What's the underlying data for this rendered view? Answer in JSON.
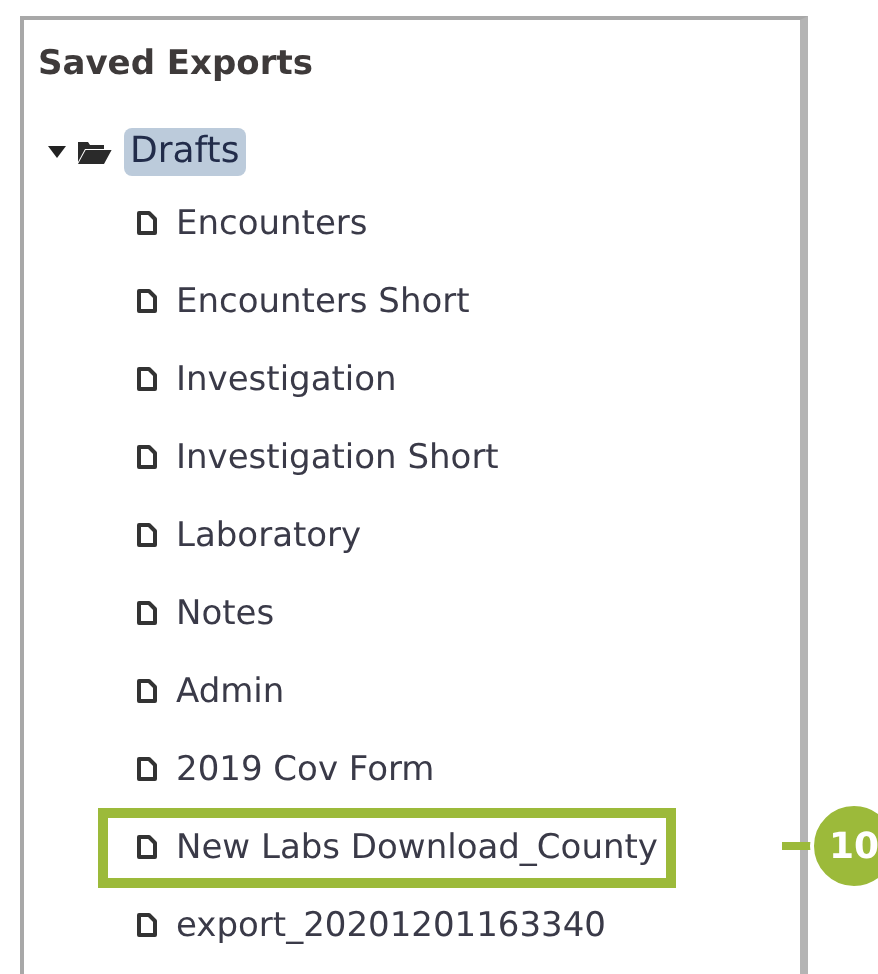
{
  "panel": {
    "title": "Saved Exports"
  },
  "tree": [
    {
      "label": "Drafts",
      "expanded": true,
      "selected": true,
      "children": [
        {
          "label": "Encounters",
          "highlighted": false
        },
        {
          "label": "Encounters Short",
          "highlighted": false
        },
        {
          "label": "Investigation",
          "highlighted": false
        },
        {
          "label": "Investigation Short",
          "highlighted": false
        },
        {
          "label": "Laboratory",
          "highlighted": false
        },
        {
          "label": "Notes",
          "highlighted": false
        },
        {
          "label": "Admin",
          "highlighted": false
        },
        {
          "label": "2019 Cov Form",
          "highlighted": false
        },
        {
          "label": "New Labs Download_County",
          "highlighted": true,
          "callout": "10"
        },
        {
          "label": "export_20201201163340",
          "highlighted": false
        }
      ]
    }
  ]
}
